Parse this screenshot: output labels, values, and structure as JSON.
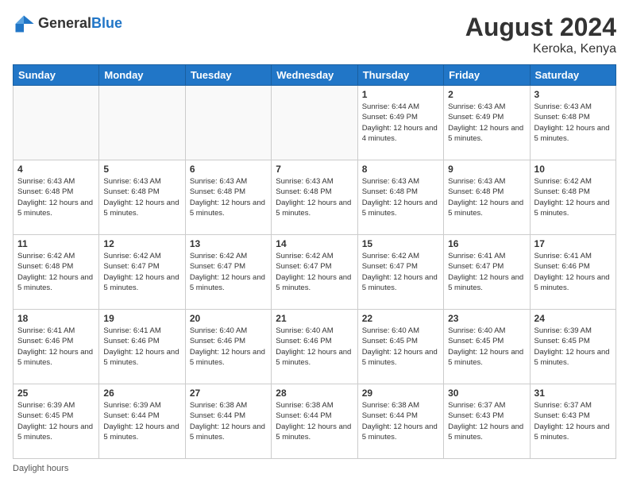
{
  "logo": {
    "general": "General",
    "blue": "Blue"
  },
  "title": {
    "month_year": "August 2024",
    "location": "Keroka, Kenya"
  },
  "days_of_week": [
    "Sunday",
    "Monday",
    "Tuesday",
    "Wednesday",
    "Thursday",
    "Friday",
    "Saturday"
  ],
  "weeks": [
    [
      {
        "day": "",
        "empty": true
      },
      {
        "day": "",
        "empty": true
      },
      {
        "day": "",
        "empty": true
      },
      {
        "day": "",
        "empty": true
      },
      {
        "day": "1",
        "sunrise": "6:44 AM",
        "sunset": "6:49 PM",
        "daylight": "12 hours and 4 minutes."
      },
      {
        "day": "2",
        "sunrise": "6:43 AM",
        "sunset": "6:49 PM",
        "daylight": "12 hours and 5 minutes."
      },
      {
        "day": "3",
        "sunrise": "6:43 AM",
        "sunset": "6:48 PM",
        "daylight": "12 hours and 5 minutes."
      }
    ],
    [
      {
        "day": "4",
        "sunrise": "6:43 AM",
        "sunset": "6:48 PM",
        "daylight": "12 hours and 5 minutes."
      },
      {
        "day": "5",
        "sunrise": "6:43 AM",
        "sunset": "6:48 PM",
        "daylight": "12 hours and 5 minutes."
      },
      {
        "day": "6",
        "sunrise": "6:43 AM",
        "sunset": "6:48 PM",
        "daylight": "12 hours and 5 minutes."
      },
      {
        "day": "7",
        "sunrise": "6:43 AM",
        "sunset": "6:48 PM",
        "daylight": "12 hours and 5 minutes."
      },
      {
        "day": "8",
        "sunrise": "6:43 AM",
        "sunset": "6:48 PM",
        "daylight": "12 hours and 5 minutes."
      },
      {
        "day": "9",
        "sunrise": "6:43 AM",
        "sunset": "6:48 PM",
        "daylight": "12 hours and 5 minutes."
      },
      {
        "day": "10",
        "sunrise": "6:42 AM",
        "sunset": "6:48 PM",
        "daylight": "12 hours and 5 minutes."
      }
    ],
    [
      {
        "day": "11",
        "sunrise": "6:42 AM",
        "sunset": "6:48 PM",
        "daylight": "12 hours and 5 minutes."
      },
      {
        "day": "12",
        "sunrise": "6:42 AM",
        "sunset": "6:47 PM",
        "daylight": "12 hours and 5 minutes."
      },
      {
        "day": "13",
        "sunrise": "6:42 AM",
        "sunset": "6:47 PM",
        "daylight": "12 hours and 5 minutes."
      },
      {
        "day": "14",
        "sunrise": "6:42 AM",
        "sunset": "6:47 PM",
        "daylight": "12 hours and 5 minutes."
      },
      {
        "day": "15",
        "sunrise": "6:42 AM",
        "sunset": "6:47 PM",
        "daylight": "12 hours and 5 minutes."
      },
      {
        "day": "16",
        "sunrise": "6:41 AM",
        "sunset": "6:47 PM",
        "daylight": "12 hours and 5 minutes."
      },
      {
        "day": "17",
        "sunrise": "6:41 AM",
        "sunset": "6:46 PM",
        "daylight": "12 hours and 5 minutes."
      }
    ],
    [
      {
        "day": "18",
        "sunrise": "6:41 AM",
        "sunset": "6:46 PM",
        "daylight": "12 hours and 5 minutes."
      },
      {
        "day": "19",
        "sunrise": "6:41 AM",
        "sunset": "6:46 PM",
        "daylight": "12 hours and 5 minutes."
      },
      {
        "day": "20",
        "sunrise": "6:40 AM",
        "sunset": "6:46 PM",
        "daylight": "12 hours and 5 minutes."
      },
      {
        "day": "21",
        "sunrise": "6:40 AM",
        "sunset": "6:46 PM",
        "daylight": "12 hours and 5 minutes."
      },
      {
        "day": "22",
        "sunrise": "6:40 AM",
        "sunset": "6:45 PM",
        "daylight": "12 hours and 5 minutes."
      },
      {
        "day": "23",
        "sunrise": "6:40 AM",
        "sunset": "6:45 PM",
        "daylight": "12 hours and 5 minutes."
      },
      {
        "day": "24",
        "sunrise": "6:39 AM",
        "sunset": "6:45 PM",
        "daylight": "12 hours and 5 minutes."
      }
    ],
    [
      {
        "day": "25",
        "sunrise": "6:39 AM",
        "sunset": "6:45 PM",
        "daylight": "12 hours and 5 minutes."
      },
      {
        "day": "26",
        "sunrise": "6:39 AM",
        "sunset": "6:44 PM",
        "daylight": "12 hours and 5 minutes."
      },
      {
        "day": "27",
        "sunrise": "6:38 AM",
        "sunset": "6:44 PM",
        "daylight": "12 hours and 5 minutes."
      },
      {
        "day": "28",
        "sunrise": "6:38 AM",
        "sunset": "6:44 PM",
        "daylight": "12 hours and 5 minutes."
      },
      {
        "day": "29",
        "sunrise": "6:38 AM",
        "sunset": "6:44 PM",
        "daylight": "12 hours and 5 minutes."
      },
      {
        "day": "30",
        "sunrise": "6:37 AM",
        "sunset": "6:43 PM",
        "daylight": "12 hours and 5 minutes."
      },
      {
        "day": "31",
        "sunrise": "6:37 AM",
        "sunset": "6:43 PM",
        "daylight": "12 hours and 5 minutes."
      }
    ]
  ],
  "footer": {
    "daylight_hours": "Daylight hours"
  }
}
